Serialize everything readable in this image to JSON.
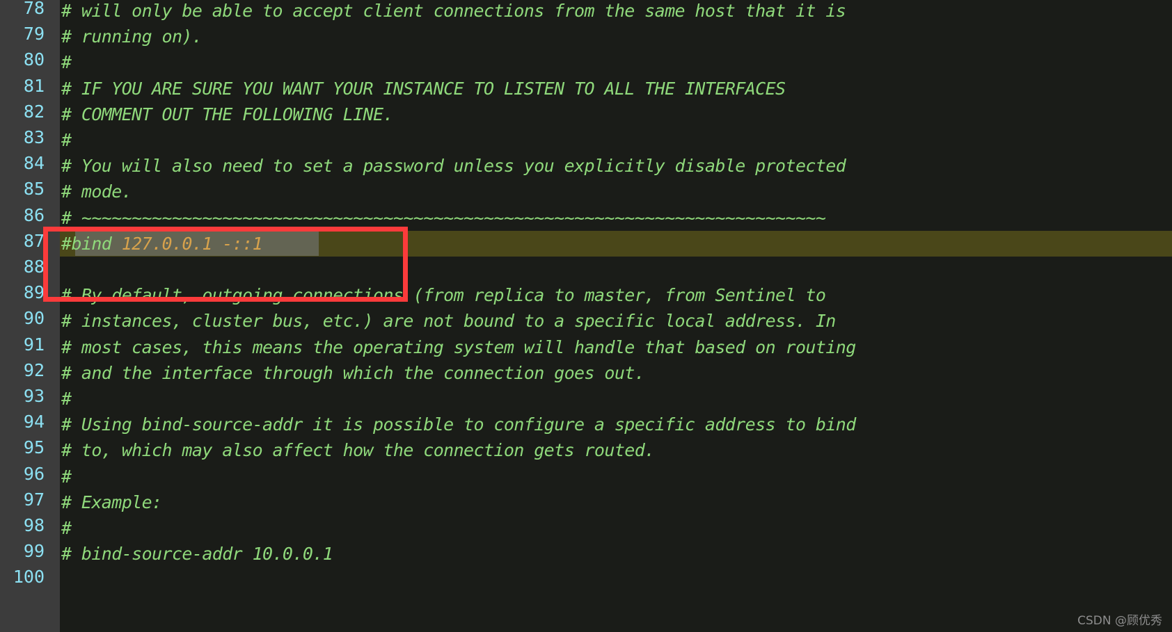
{
  "editor": {
    "file_kind": "redis.conf",
    "theme": {
      "background": "#1a1c18",
      "gutter_background": "#3c3c3c",
      "line_number_color": "#8ce0f2",
      "comment_color": "#8fd97b",
      "value_color": "#d7a24c",
      "current_line_highlight": "#4a4719",
      "selection_color": "#787c84",
      "annotation_color": "#fb3b3b"
    },
    "first_visible_line": 78,
    "last_visible_line": 100,
    "highlighted_line": 87,
    "lines": [
      {
        "number": "78",
        "text": "# will only be able to accept client connections from the same host that it is"
      },
      {
        "number": "79",
        "text": "# running on)."
      },
      {
        "number": "80",
        "text": "#"
      },
      {
        "number": "81",
        "text": "# IF YOU ARE SURE YOU WANT YOUR INSTANCE TO LISTEN TO ALL THE INTERFACES"
      },
      {
        "number": "82",
        "text": "# COMMENT OUT THE FOLLOWING LINE."
      },
      {
        "number": "83",
        "text": "#"
      },
      {
        "number": "84",
        "text": "# You will also need to set a password unless you explicitly disable protected"
      },
      {
        "number": "85",
        "text": "# mode."
      },
      {
        "number": "86",
        "text": "# ~~~~~~~~~~~~~~~~~~~~~~~~~~~~~~~~~~~~~~~~~~~~~~~~~~~~~~~~~~~~~~~~~~~~~~~~~~"
      },
      {
        "number": "87",
        "text": "#bind 127.0.0.1 -::1"
      },
      {
        "number": "88",
        "text": ""
      },
      {
        "number": "89",
        "text": "# By default, outgoing connections (from replica to master, from Sentinel to"
      },
      {
        "number": "90",
        "text": "# instances, cluster bus, etc.) are not bound to a specific local address. In"
      },
      {
        "number": "91",
        "text": "# most cases, this means the operating system will handle that based on routing"
      },
      {
        "number": "92",
        "text": "# and the interface through which the connection goes out."
      },
      {
        "number": "93",
        "text": "#"
      },
      {
        "number": "94",
        "text": "# Using bind-source-addr it is possible to configure a specific address to bind"
      },
      {
        "number": "95",
        "text": "# to, which may also affect how the connection gets routed."
      },
      {
        "number": "96",
        "text": "#"
      },
      {
        "number": "97",
        "text": "# Example:"
      },
      {
        "number": "98",
        "text": "#"
      },
      {
        "number": "99",
        "text": "# bind-source-addr 10.0.0.1"
      },
      {
        "number": "100",
        "text": ""
      }
    ],
    "highlighted_line_tokens": {
      "directive": "#bind",
      "separator": " ",
      "value": "127.0.0.1 -::1"
    }
  },
  "annotation": {
    "label": "red-rectangle-around-bind-directive",
    "covers_lines": "87-88"
  },
  "watermark": {
    "text": "CSDN @顾优秀"
  }
}
